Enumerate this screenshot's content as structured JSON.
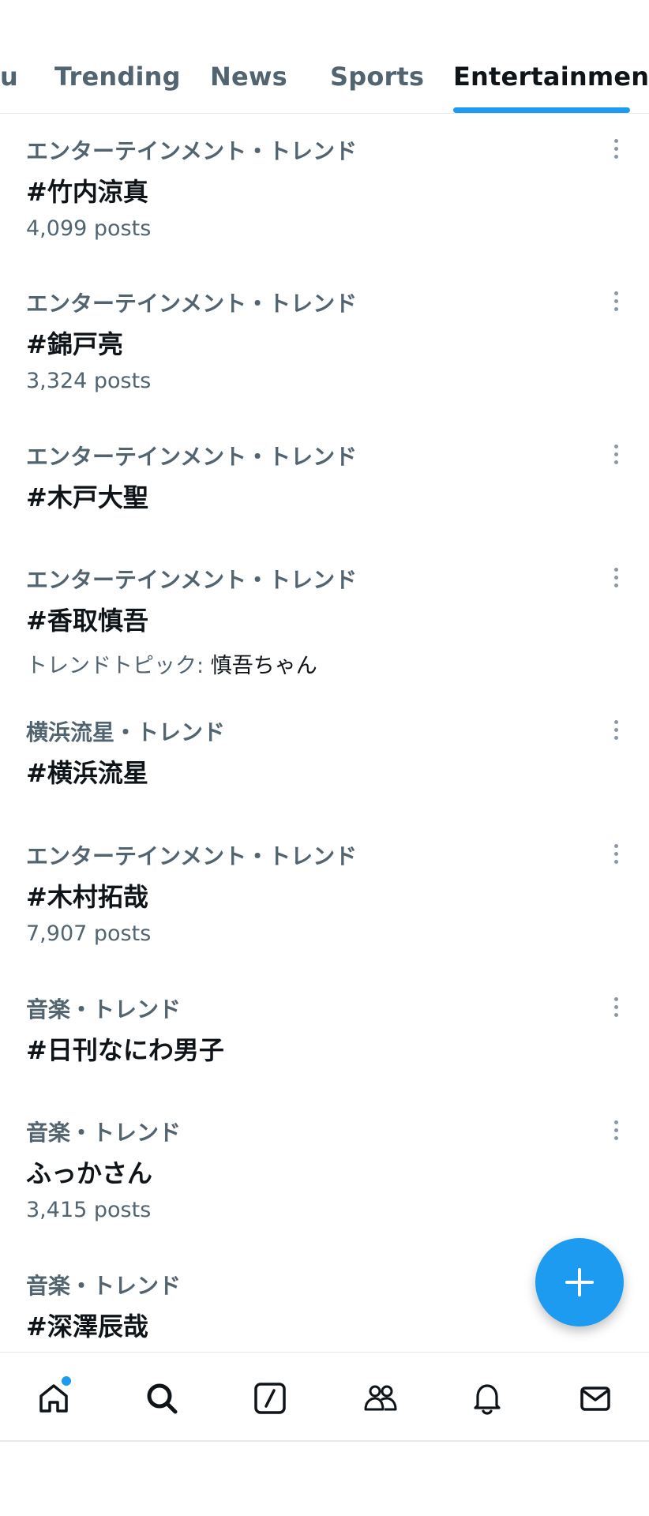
{
  "tabs": [
    {
      "label": "u"
    },
    {
      "label": "Trending"
    },
    {
      "label": "News"
    },
    {
      "label": "Sports"
    },
    {
      "label": "Entertainment",
      "active": true
    }
  ],
  "trends": [
    {
      "category": "エンターテインメント・トレンド",
      "title": "#竹内涼真",
      "meta": "4,099 posts"
    },
    {
      "category": "エンターテインメント・トレンド",
      "title": "#錦戸亮",
      "meta": "3,324 posts"
    },
    {
      "category": "エンターテインメント・トレンド",
      "title": "#木戸大聖"
    },
    {
      "category": "エンターテインメント・トレンド",
      "title": "#香取慎吾",
      "topic_label": "トレンドトピック:",
      "topic_name": "慎吾ちゃん"
    },
    {
      "category": "横浜流星・トレンド",
      "title": "#横浜流星"
    },
    {
      "category": "エンターテインメント・トレンド",
      "title": "#木村拓哉",
      "meta": "7,907 posts"
    },
    {
      "category": "音楽・トレンド",
      "title": "#日刊なにわ男子"
    },
    {
      "category": "音楽・トレンド",
      "title": "ふっかさん",
      "meta": "3,415 posts"
    },
    {
      "category": "音楽・トレンド",
      "title": "#深澤辰哉"
    }
  ],
  "fab": {
    "icon": "plus-icon"
  },
  "bottom_nav": [
    {
      "icon": "home-icon",
      "has_notification_dot": true
    },
    {
      "icon": "search-icon"
    },
    {
      "icon": "grok-icon"
    },
    {
      "icon": "communities-icon"
    },
    {
      "icon": "bell-icon"
    },
    {
      "icon": "mail-icon"
    }
  ],
  "colors": {
    "accent": "#1d9bf0",
    "text_primary": "#0f1419",
    "text_secondary": "#536471"
  }
}
